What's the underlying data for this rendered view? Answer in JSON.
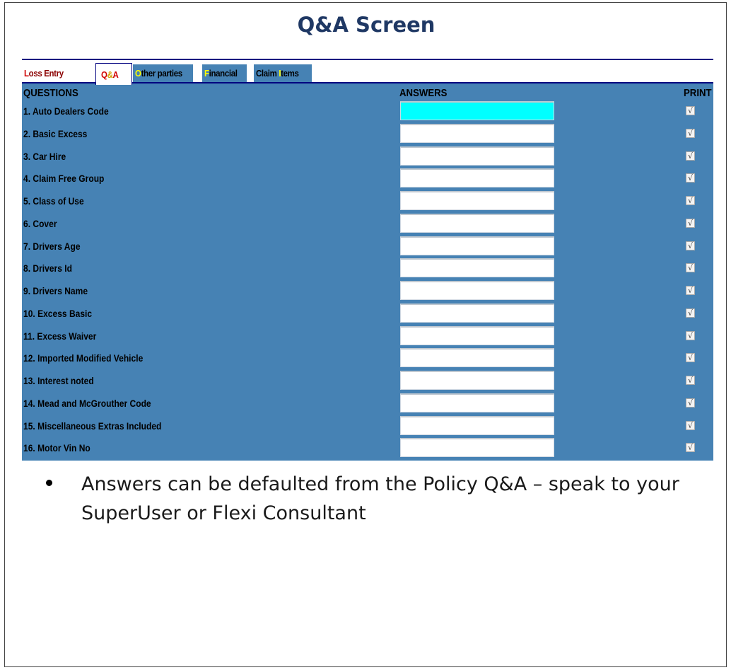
{
  "slide": {
    "title": "Q&A Screen",
    "bullet": "Answers can be defaulted from the Policy Q&A – speak to your SuperUser or Flexi Consultant"
  },
  "colors": {
    "panel_bg": "#4682b4",
    "focused_input": "#00ffff",
    "title_color": "#1f3864",
    "tab_line": "#000080",
    "hotkey_yellow": "#ffff00",
    "hotkey_red": "#d00000",
    "loss_entry_text": "#8b0000"
  },
  "tabs": [
    {
      "hot": "L",
      "rest": "oss Entry",
      "active": false
    },
    {
      "hot": "Q",
      "mid": "&",
      "rest": "A",
      "active": true
    },
    {
      "hot": "O",
      "rest": "ther parties",
      "active": false
    },
    {
      "hot": "F",
      "rest": "inancial",
      "active": false
    },
    {
      "pre": "Claim ",
      "hot": "I",
      "rest": "tems",
      "active": false
    }
  ],
  "headers": {
    "questions": "QUESTIONS",
    "answers": "ANSWERS",
    "print": "PRINT"
  },
  "rows": [
    {
      "q": "1. Auto Dealers Code",
      "answer": "",
      "print": true
    },
    {
      "q": "2. Basic Excess",
      "answer": "",
      "print": true
    },
    {
      "q": "3. Car Hire",
      "answer": "",
      "print": true
    },
    {
      "q": "4. Claim Free Group",
      "answer": "",
      "print": true
    },
    {
      "q": "5. Class of Use",
      "answer": "",
      "print": true
    },
    {
      "q": "6. Cover",
      "answer": "",
      "print": true
    },
    {
      "q": "7. Drivers Age",
      "answer": "",
      "print": true
    },
    {
      "q": "8. Drivers Id",
      "answer": "",
      "print": true
    },
    {
      "q": "9. Drivers Name",
      "answer": "",
      "print": true
    },
    {
      "q": "10. Excess Basic",
      "answer": "",
      "print": true
    },
    {
      "q": "11. Excess Waiver",
      "answer": "",
      "print": true
    },
    {
      "q": "12. Imported Modified Vehicle",
      "answer": "",
      "print": true
    },
    {
      "q": "13. Interest noted",
      "answer": "",
      "print": true
    },
    {
      "q": "14. Mead and McGrouther Code",
      "answer": "",
      "print": true
    },
    {
      "q": "15. Miscellaneous Extras Included",
      "answer": "",
      "print": true
    },
    {
      "q": "16. Motor Vin No",
      "answer": "",
      "print": true
    }
  ]
}
